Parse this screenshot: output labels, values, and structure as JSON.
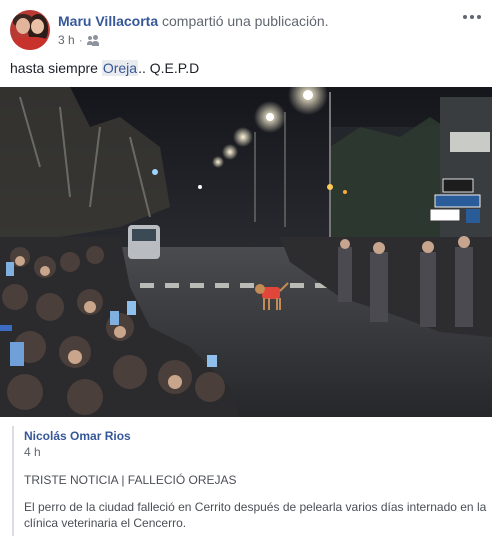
{
  "post": {
    "author": "Maru Villacorta",
    "action_text": "compartió una publicación.",
    "time": "3 h",
    "audience_icon": "friends-icon",
    "more_icon": "more-dots-icon",
    "text_before": "hasta siempre ",
    "mention": "Oreja",
    "text_after": ".. Q.E.P.D"
  },
  "photo": {
    "description_icon": "street-crowd-dog-photo",
    "sign_labels": [
      "",
      ""
    ]
  },
  "shared": {
    "author": "Nicolás Omar Rios",
    "time": "4 h",
    "title": "TRISTE NOTICIA | FALLECIÓ OREJAS",
    "description": "El perro de la ciudad falleció en Cerrito después de pelearla varios días internado en la clínica veterinaria el Cencerro."
  },
  "colors": {
    "link": "#365899",
    "meta": "#616770",
    "text": "#1d2129",
    "mention_bg": "#e9ebee",
    "quote_border": "#dadde1"
  }
}
